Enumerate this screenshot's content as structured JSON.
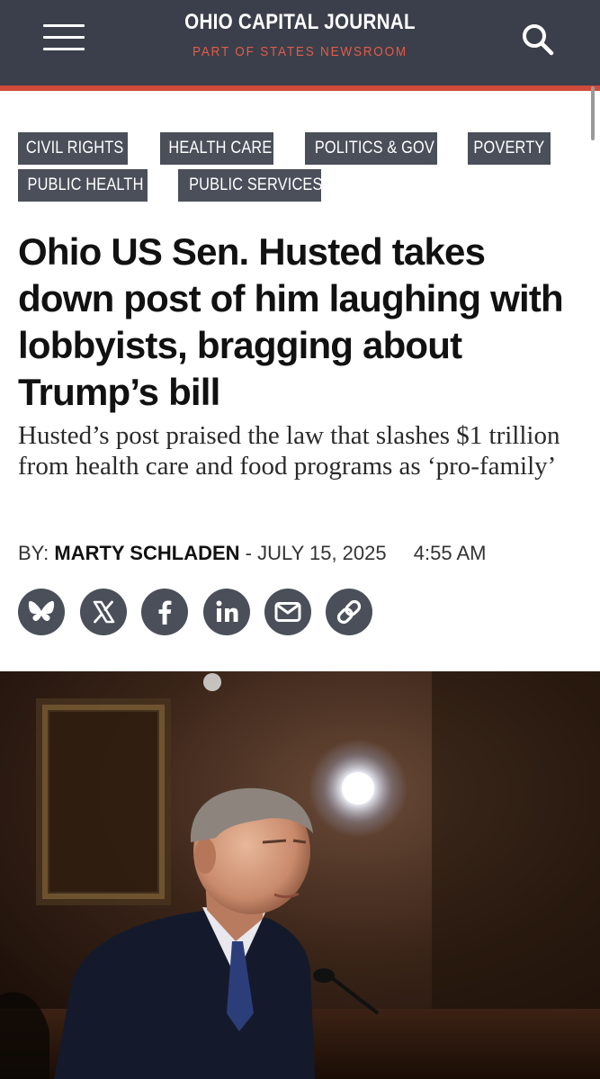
{
  "header": {
    "site_name": "OHIO CAPITAL JOURNAL",
    "tagline": "PART OF STATES NEWSROOM",
    "menu_icon": "hamburger-menu-icon",
    "search_icon": "search-icon"
  },
  "colors": {
    "header_bg": "#3a3f4b",
    "accent_red": "#d04a3a",
    "tag_bg": "#4a4f5a",
    "tag_text": "#ffffff"
  },
  "tags": [
    "CIVIL RIGHTS",
    "HEALTH CARE",
    "POLITICS & GOV",
    "POVERTY",
    "PUBLIC HEALTH",
    "PUBLIC SERVICES"
  ],
  "article": {
    "headline": "Ohio US Sen. Husted takes down post of him laughing with lobbyists, bragging about Trump’s bill",
    "dek": "Husted’s post praised the law that slashes $1 trillion from health care and food programs as ‘pro-family’",
    "byline_prefix": "BY:",
    "author": "MARTY SCHLADEN",
    "separator": "-",
    "date": "JULY 15, 2025",
    "time": "4:55 AM"
  },
  "share": {
    "icons": [
      "bluesky-icon",
      "x-icon",
      "facebook-icon",
      "linkedin-icon",
      "email-icon",
      "link-icon"
    ]
  },
  "hero_image": {
    "subject": "photo"
  }
}
